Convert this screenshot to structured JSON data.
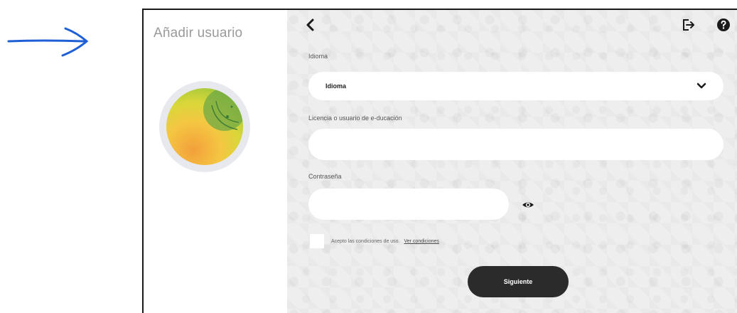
{
  "left_panel": {
    "title": "Añadir usuario"
  },
  "main": {
    "language_label": "Idioma",
    "language_value": "Idioma",
    "license_label": "Licencia o usuario de e-ducación",
    "license_value": "",
    "password_label": "Contraseña",
    "password_value": "",
    "terms_text": "Acepto las condiciones de uso.",
    "terms_link": "Ver condiciones",
    "terms_checked": false,
    "next_button": "Siguiente"
  },
  "icons": {
    "back": "chevron-left-icon",
    "logout": "logout-icon",
    "help": "help-icon",
    "dropdown": "chevron-down-icon",
    "show_password": "eye-icon"
  },
  "colors": {
    "annotation_blue": "#1f5fd6",
    "button_dark": "#2b2b2b",
    "panel_bg": "#eeeeee"
  }
}
